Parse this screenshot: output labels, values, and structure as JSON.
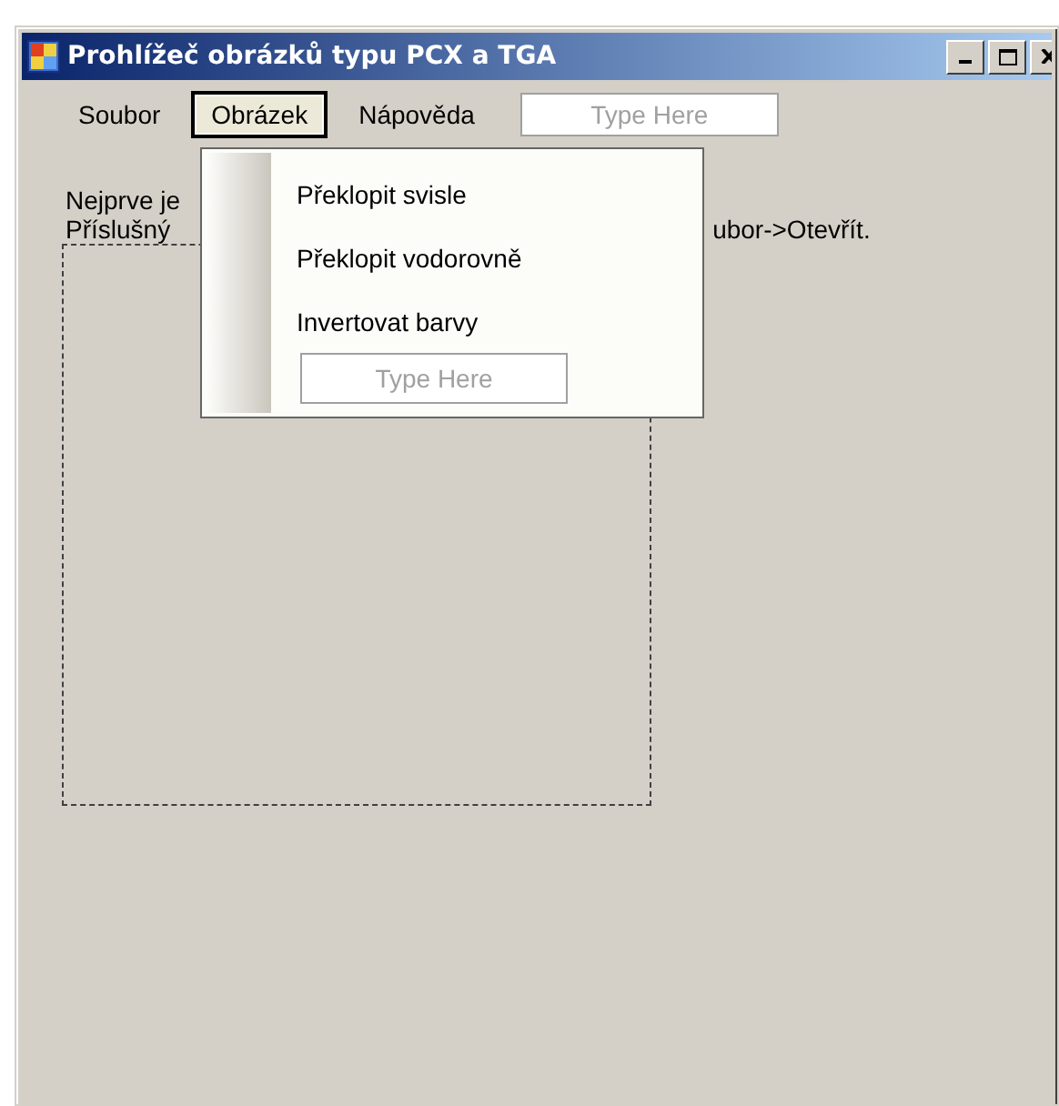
{
  "window": {
    "title": "Prohlížeč obrázků typu PCX a TGA"
  },
  "menu_bar": {
    "items": [
      {
        "label": "Soubor",
        "selected": false
      },
      {
        "label": "Obrázek",
        "selected": true
      },
      {
        "label": "Nápověda",
        "selected": false
      }
    ],
    "new_item": {
      "placeholder": "Type Here"
    }
  },
  "open_menu": {
    "items": [
      {
        "label": "Překlopit svisle"
      },
      {
        "label": "Překlopit vodorovně"
      },
      {
        "label": "Invertovat barvy"
      }
    ],
    "new_item": {
      "placeholder": "Type Here"
    }
  },
  "info_text": {
    "line_1": "Nejprve je",
    "line_2_start": "Příslušný",
    "line_2_end": "ubor->Otevřít."
  }
}
